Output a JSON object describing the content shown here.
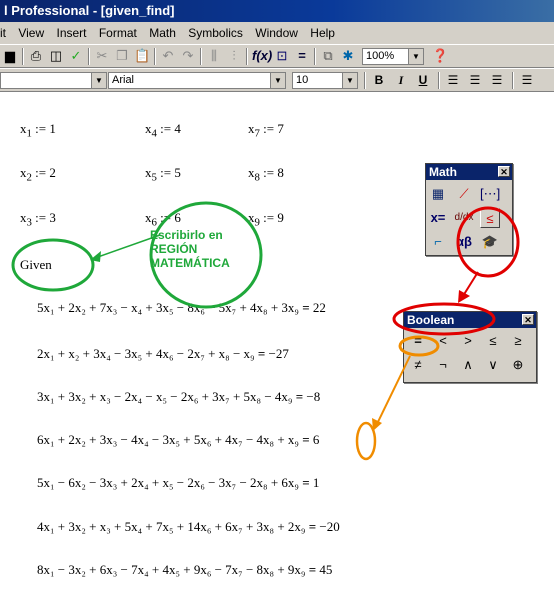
{
  "window": {
    "title": "l Professional - [given_find]"
  },
  "menu": [
    "it",
    "View",
    "Insert",
    "Format",
    "Math",
    "Symbolics",
    "Window",
    "Help"
  ],
  "toolbar": {
    "zoom": "100%",
    "font": "Arial",
    "font_size": "10",
    "bold": "B",
    "italic": "I",
    "underline": "U"
  },
  "definitions": [
    {
      "var": "x",
      "sub": "1",
      "val": "1"
    },
    {
      "var": "x",
      "sub": "4",
      "val": "4"
    },
    {
      "var": "x",
      "sub": "7",
      "val": "7"
    },
    {
      "var": "x",
      "sub": "2",
      "val": "2"
    },
    {
      "var": "x",
      "sub": "5",
      "val": "5"
    },
    {
      "var": "x",
      "sub": "8",
      "val": "8"
    },
    {
      "var": "x",
      "sub": "3",
      "val": "3"
    },
    {
      "var": "x",
      "sub": "6",
      "val": "6"
    },
    {
      "var": "x",
      "sub": "9",
      "val": "9"
    }
  ],
  "given_label": "Given",
  "annotation": {
    "line1": "Escribirlo en",
    "line2": "REGIÓN",
    "line3": "MATEMÁTICA"
  },
  "math_palette": {
    "title": "Math",
    "close": "✕"
  },
  "boolean_palette": {
    "title": "Boolean",
    "close": "✕",
    "row1": [
      "=",
      "<",
      ">",
      "≤",
      "≥"
    ],
    "row2": [
      "≠",
      "¬",
      "∧",
      "∨",
      "⊕"
    ]
  },
  "equations": [
    {
      "lhs": "5x₁ + 2x₂ + 7x₃ − x₄ + 3x₅ − 8x₆ − 5x₇ + 4x₈ + 3x₉",
      "rhs": "22"
    },
    {
      "lhs": "2x₁ + x₂ + 3x₄ − 3x₅ + 4x₆ − 2x₇ + x₈ − x₉",
      "rhs": "−27"
    },
    {
      "lhs": "3x₁ + 3x₂ + x₃ − 2x₄ − x₅ − 2x₆ + 3x₇ + 5x₈ − 4x₉",
      "rhs": "−8"
    },
    {
      "lhs": "6x₁ + 2x₂ + 3x₃ − 4x₄ − 3x₅ + 5x₆ + 4x₇ − 4x₈ + x₉",
      "rhs": "6"
    },
    {
      "lhs": "5x₁ − 6x₂ − 3x₃ + 2x₄ + x₅ − 2x₆ − 3x₇ − 2x₈ + 6x₉",
      "rhs": "1"
    },
    {
      "lhs": "4x₁ + 3x₂ + x₃ + 5x₄ + 7x₅ + 14x₆ + 6x₇ + 3x₈ + 2x₉",
      "rhs": "−20"
    },
    {
      "lhs": "8x₁ − 3x₂ + 6x₃ − 7x₄ + 4x₅ + 9x₆ − 7x₇ − 8x₈ + 9x₉",
      "rhs": "45"
    }
  ],
  "eq_symbol": "=",
  "assign_symbol": ":="
}
